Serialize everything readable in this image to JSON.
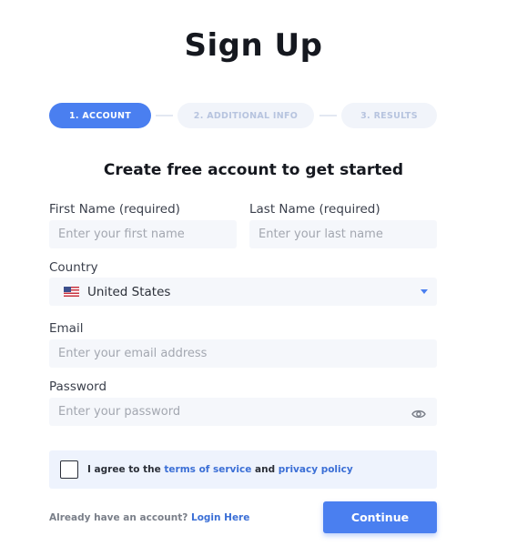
{
  "page": {
    "title": "Sign Up"
  },
  "steps": [
    {
      "label": "1. Account",
      "state": "active"
    },
    {
      "label": "2. Additional Info",
      "state": "inactive"
    },
    {
      "label": "3. Results",
      "state": "inactive"
    }
  ],
  "form": {
    "subtitle": "Create free account to get started",
    "first_name": {
      "label": "First Name (required)",
      "placeholder": "Enter your first name",
      "value": ""
    },
    "last_name": {
      "label": "Last Name (required)",
      "placeholder": "Enter your last name",
      "value": ""
    },
    "country": {
      "label": "Country",
      "selected": "United States",
      "flag_icon": "us-flag-icon"
    },
    "email": {
      "label": "Email",
      "placeholder": "Enter your email address",
      "value": ""
    },
    "password": {
      "label": "Password",
      "placeholder": "Enter your password",
      "value": "",
      "toggle_icon": "eye-icon"
    },
    "agreement": {
      "checked": false,
      "prefix": "I agree to the",
      "terms_link": "terms of service",
      "and": "and",
      "privacy_link": "privacy policy"
    }
  },
  "footer": {
    "already_text": "Already have an account?",
    "login_link": "Login Here",
    "continue_label": "Continue"
  },
  "colors": {
    "accent": "#4a7ff0",
    "link": "#3b6fd6",
    "field_bg": "#f5f7fb",
    "agree_bg": "#eef3fd",
    "step_inactive_bg": "#f1f4fa",
    "step_inactive_text": "#b7c4df"
  }
}
